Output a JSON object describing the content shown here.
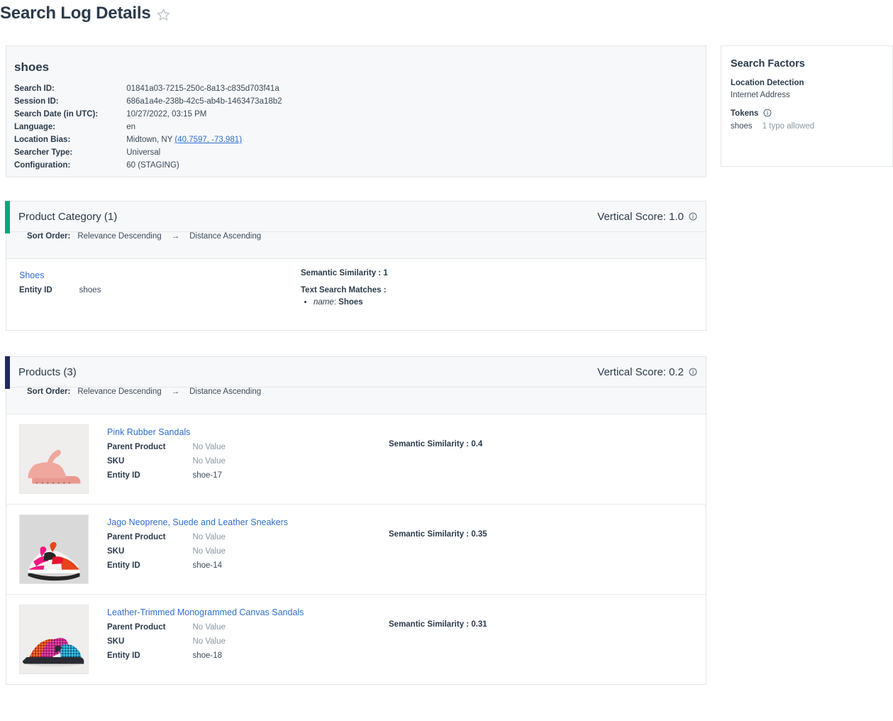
{
  "page": {
    "title": "Search Log Details",
    "favorite_icon": "star-outline-icon"
  },
  "summary": {
    "query": "shoes",
    "fields": [
      {
        "label": "Search ID:",
        "value": "01841a03-7215-250c-8a13-c835d703f41a"
      },
      {
        "label": "Session ID:",
        "value": "686a1a4e-238b-42c5-ab4b-1463473a18b2"
      },
      {
        "label": "Search Date (in UTC):",
        "value": "10/27/2022, 03:15 PM"
      },
      {
        "label": "Language:",
        "value": "en"
      },
      {
        "label": "Location Bias:",
        "value": "Midtown, NY",
        "link": "(40.7597, -73.981)"
      },
      {
        "label": "Searcher Type:",
        "value": "Universal"
      },
      {
        "label": "Configuration:",
        "value": "60 (STAGING)"
      }
    ]
  },
  "search_factors": {
    "title": "Search Factors",
    "location_detection": {
      "heading": "Location Detection",
      "value": "Internet Address"
    },
    "tokens": {
      "heading": "Tokens",
      "info_icon": "info-circle-icon",
      "items": [
        {
          "token": "shoes",
          "note": "1 typo allowed"
        }
      ]
    }
  },
  "sections": [
    {
      "name": "Product Category (1)",
      "score_label": "Vertical Score: 1.0",
      "info_icon": "info-circle-icon",
      "accent_color": "#00a87a",
      "sort": {
        "label": "Sort Order:",
        "primary": "Relevance Descending",
        "arrow": "→",
        "secondary": "Distance Ascending"
      },
      "results": [
        {
          "kind": "category",
          "name": "Shoes",
          "attributes": [
            {
              "key": "Entity ID",
              "value": "shoes",
              "no_value": false
            }
          ],
          "semantic_similarity": "Semantic Similarity : 1",
          "text_search_matches_title": "Text Search Matches :",
          "text_search_matches": [
            {
              "field": "name",
              "value": "Shoes"
            }
          ]
        }
      ]
    },
    {
      "name": "Products (3)",
      "score_label": "Vertical Score: 0.2",
      "info_icon": "info-circle-icon",
      "accent_color": "#1f2a5e",
      "sort": {
        "label": "Sort Order:",
        "primary": "Relevance Descending",
        "arrow": "→",
        "secondary": "Distance Ascending"
      },
      "results": [
        {
          "kind": "product",
          "thumbnail": "pink-rubber-sandal-thumbnail",
          "name": "Pink Rubber Sandals",
          "attributes": [
            {
              "key": "Parent Product",
              "value": "No Value",
              "no_value": true
            },
            {
              "key": "SKU",
              "value": "No Value",
              "no_value": true
            },
            {
              "key": "Entity ID",
              "value": "shoe-17",
              "no_value": false
            }
          ],
          "semantic_similarity": "Semantic Similarity : 0.4"
        },
        {
          "kind": "product",
          "thumbnail": "multicolor-sneaker-thumbnail",
          "name": "Jago Neoprene, Suede and Leather Sneakers",
          "attributes": [
            {
              "key": "Parent Product",
              "value": "No Value",
              "no_value": true
            },
            {
              "key": "SKU",
              "value": "No Value",
              "no_value": true
            },
            {
              "key": "Entity ID",
              "value": "shoe-14",
              "no_value": false
            }
          ],
          "semantic_similarity": "Semantic Similarity : 0.35"
        },
        {
          "kind": "product",
          "thumbnail": "patterned-slide-sandal-thumbnail",
          "name": "Leather-Trimmed Monogrammed Canvas Sandals",
          "attributes": [
            {
              "key": "Parent Product",
              "value": "No Value",
              "no_value": true
            },
            {
              "key": "SKU",
              "value": "No Value",
              "no_value": true
            },
            {
              "key": "Entity ID",
              "value": "shoe-18",
              "no_value": false
            }
          ],
          "semantic_similarity": "Semantic Similarity : 0.31"
        }
      ]
    }
  ],
  "colors": {
    "link": "#2f6fd0",
    "text": "#2b3a4a",
    "muted": "#8a97a3",
    "card_bg": "#f7f8f9",
    "border": "#e3e6e8"
  }
}
